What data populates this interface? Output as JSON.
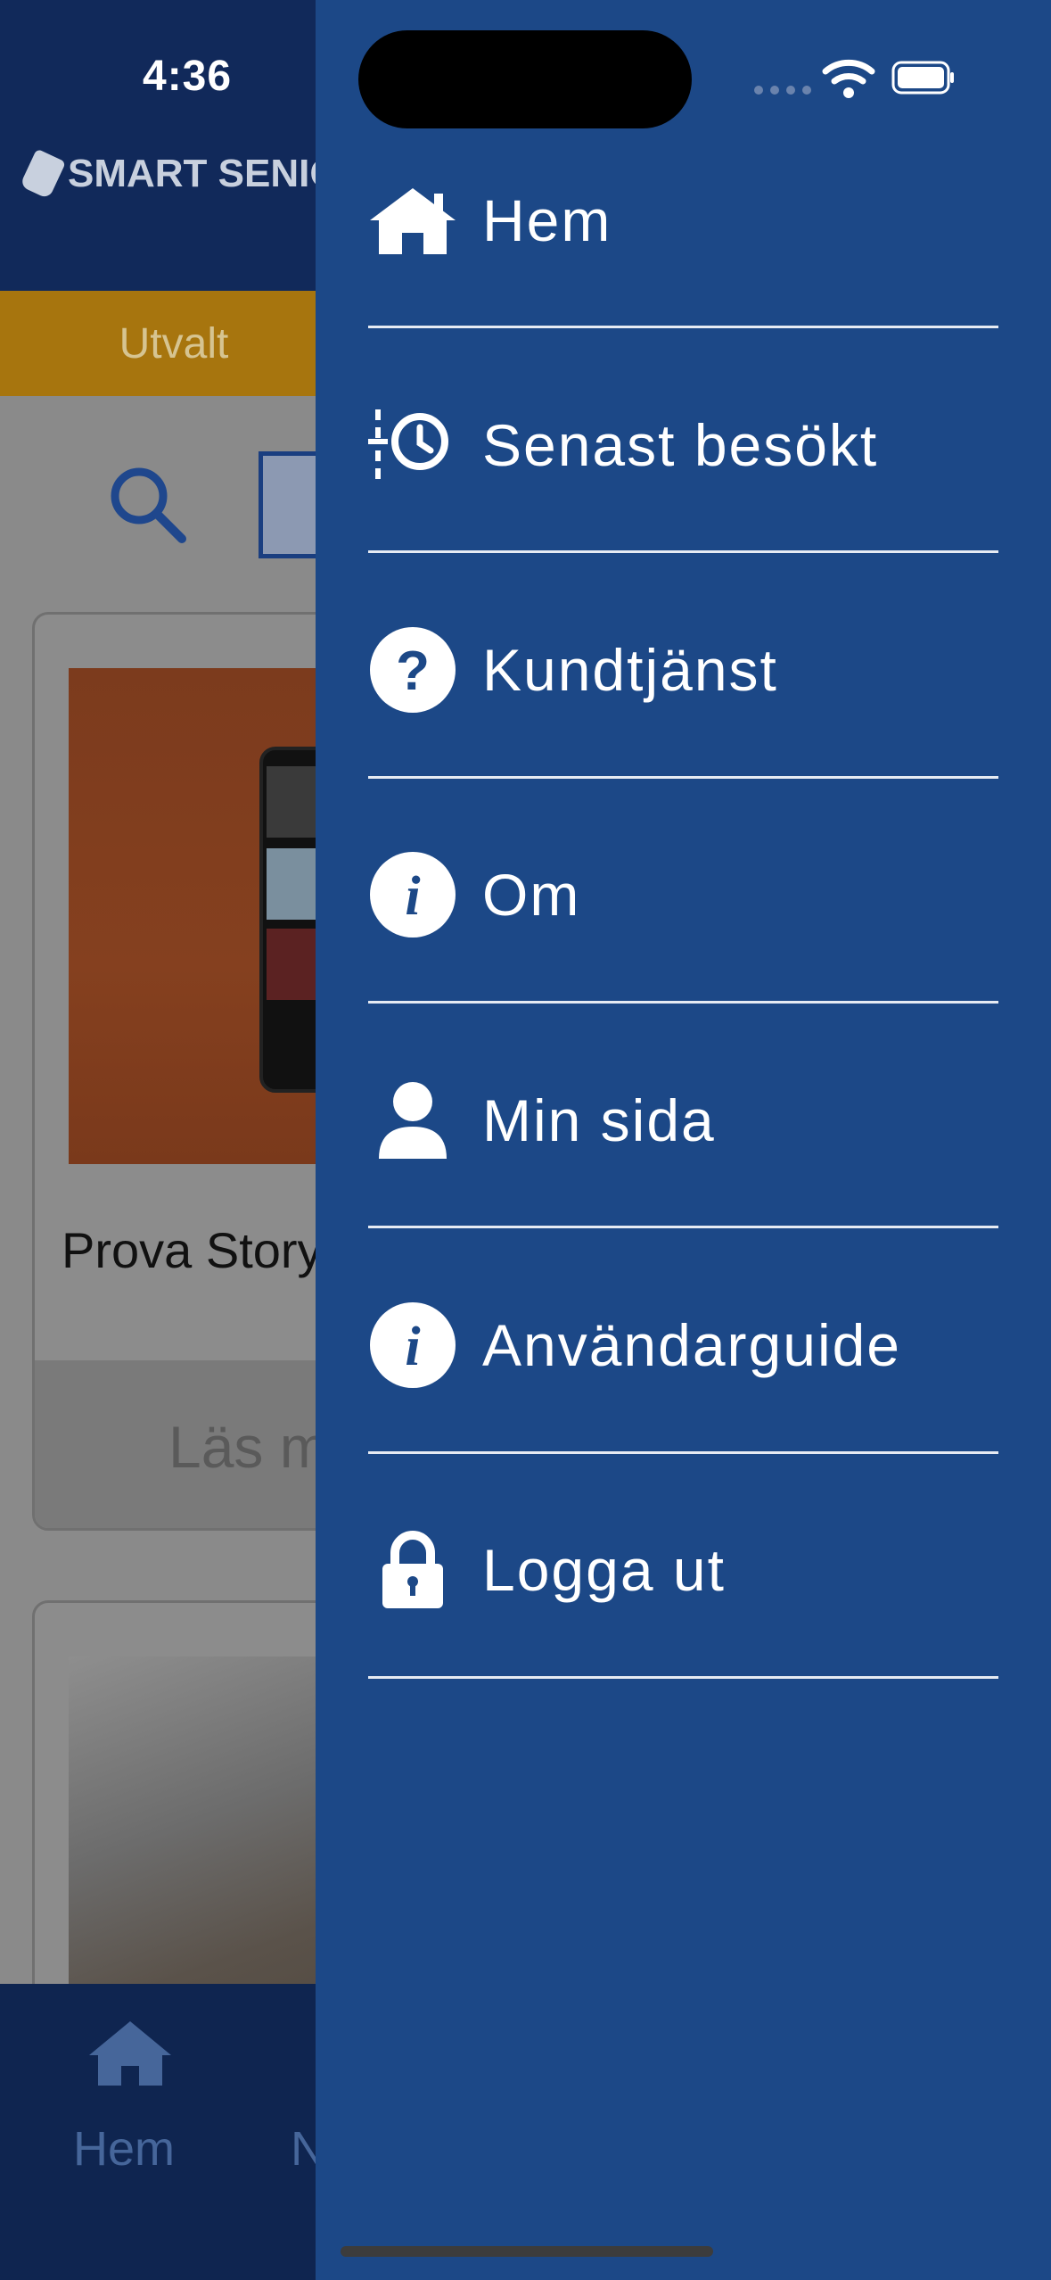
{
  "status_bar": {
    "time": "4:36"
  },
  "app": {
    "logo_text": "SMART SENIOR",
    "tab_selected": "Utvalt",
    "search": {
      "icon": "search-icon"
    },
    "cards": [
      {
        "title": "Prova Story",
        "button_label": "Läs m"
      },
      {
        "title": ""
      }
    ],
    "bottom_nav": {
      "home_label": "Hem",
      "next_label": "N"
    }
  },
  "drawer": {
    "items": [
      {
        "label": "Hem",
        "icon": "home-icon"
      },
      {
        "label": "Senast besökt",
        "icon": "history-icon"
      },
      {
        "label": "Kundtjänst",
        "icon": "question-icon"
      },
      {
        "label": "Om",
        "icon": "info-icon"
      },
      {
        "label": "Min sida",
        "icon": "user-icon"
      },
      {
        "label": "Användarguide",
        "icon": "info-icon"
      },
      {
        "label": "Logga ut",
        "icon": "lock-icon"
      }
    ]
  },
  "colors": {
    "drawer_bg": "#1c4887",
    "header_bg": "#11295a",
    "tab_bg": "#a7750e",
    "accent_blue": "#1a3e80"
  }
}
